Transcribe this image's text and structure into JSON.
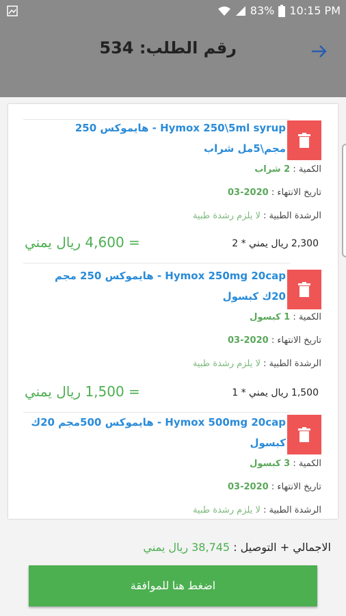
{
  "status_bar": {
    "battery": "83%",
    "time": "10:15 PM"
  },
  "header": {
    "title": "رقم الطلب: 534"
  },
  "items": [
    {
      "name_line1": "Hymox 250\\5ml syrup - هايموكس 250",
      "name_line2": "مجم\\5مل شراب",
      "qty_label": "الكمية :",
      "qty_value": "2 شراب",
      "exp_label": "تاريخ الانتهاء :",
      "exp_value": "2020-03",
      "rx_label": "الرشدة الطبية :",
      "rx_value": "لا يلزم رشدة طبية",
      "unit_price": "2,300 ريال يمني * 2",
      "total": "= 4,600 ريال يمني"
    },
    {
      "name_line1": "Hymox 250mg 20cap - هايموكس 250 مجم",
      "name_line2": "20ك كبسول",
      "qty_label": "الكمية :",
      "qty_value": "1 كبسول",
      "exp_label": "تاريخ الانتهاء :",
      "exp_value": "2020-03",
      "rx_label": "الرشدة الطبية :",
      "rx_value": "لا يلزم رشدة طبية",
      "unit_price": "1,500 ريال يمني * 1",
      "total": "= 1,500 ريال يمني"
    },
    {
      "name_line1": "Hymox 500mg 20cap - هايموكس 500مجم 20ك",
      "name_line2": "كبسول",
      "qty_label": "الكمية :",
      "qty_value": "3 كبسول",
      "exp_label": "تاريخ الانتهاء :",
      "exp_value": "2020-03",
      "rx_label": "الرشدة الطبية :",
      "rx_value": "لا يلزم رشدة طبية"
    }
  ],
  "footer": {
    "grand_label": "الاجمالي + التوصيل :",
    "grand_amount": "38,745 ريال يمني",
    "confirm_label": "اضغط هنا للموافقة"
  }
}
